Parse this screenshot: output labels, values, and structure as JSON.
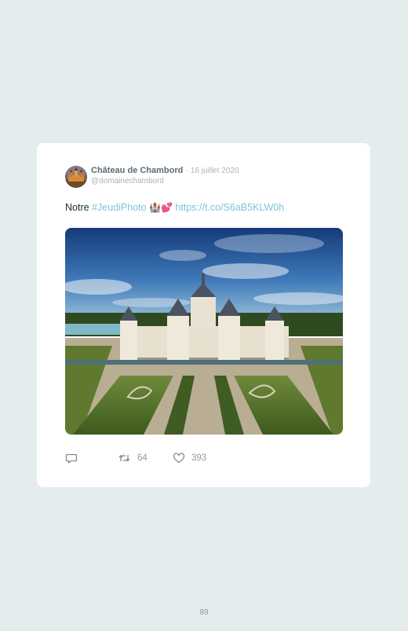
{
  "tweet": {
    "author_name": "Château de Chambord",
    "separator": "·",
    "date": "16 juillet 2020",
    "handle": "@domainechambord",
    "text_prefix": "Notre ",
    "hashtag": "#JeudiPhoto",
    "emoji": "🏰💕",
    "link": "https://t.co/S6aB5KLW0h",
    "avatar_icon": "castle-avatar-icon",
    "media_alt": "aerial photo of château with gardens"
  },
  "actions": {
    "reply_count": "",
    "retweet_count": "64",
    "like_count": "393"
  },
  "page": {
    "number": "89"
  },
  "colors": {
    "background": "#e5ecee",
    "card": "#ffffff",
    "link": "#7cc4de",
    "muted": "#a8b3b9"
  }
}
